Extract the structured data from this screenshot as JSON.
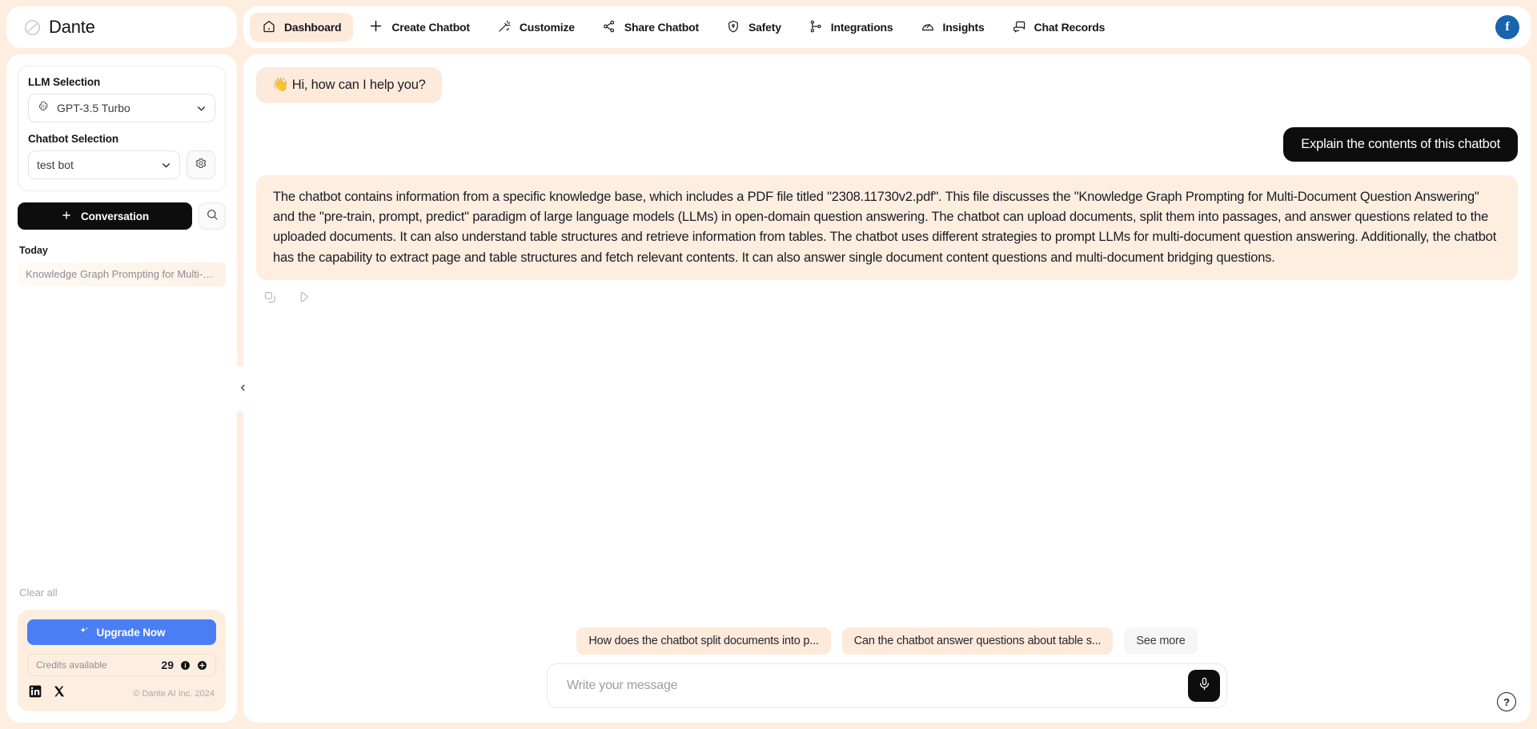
{
  "brand": {
    "name": "Dante",
    "logo_icon": "dante-logo-icon"
  },
  "sidebar": {
    "llm_label": "LLM Selection",
    "llm_value": "GPT-3.5 Turbo",
    "llm_icon": "openai-icon",
    "chatbot_label": "Chatbot Selection",
    "chatbot_value": "test bot",
    "settings_icon": "gear-icon",
    "conversation_button": "Conversation",
    "search_icon": "search-icon",
    "today_label": "Today",
    "conversations": [
      {
        "title": "Knowledge Graph Prompting for Multi-D..."
      }
    ],
    "clear_all": "Clear all",
    "upgrade_button": "Upgrade Now",
    "credits_label": "Credits available",
    "credits_value": "29",
    "info_icon": "info-icon",
    "add_icon": "plus-circle-icon",
    "social": [
      {
        "name": "linkedin-icon"
      },
      {
        "name": "x-twitter-icon"
      }
    ],
    "copyright": "© Dante AI Inc. 2024",
    "collapse_icon": "chevron-left-icon"
  },
  "topbar": {
    "nav": [
      {
        "label": "Dashboard",
        "icon": "home-icon",
        "active": true
      },
      {
        "label": "Create Chatbot",
        "icon": "plus-icon",
        "active": false
      },
      {
        "label": "Customize",
        "icon": "magic-wand-icon",
        "active": false
      },
      {
        "label": "Share Chatbot",
        "icon": "share-icon",
        "active": false
      },
      {
        "label": "Safety",
        "icon": "shield-icon",
        "active": false
      },
      {
        "label": "Integrations",
        "icon": "integrations-icon",
        "active": false
      },
      {
        "label": "Insights",
        "icon": "gauge-icon",
        "active": false
      },
      {
        "label": "Chat Records",
        "icon": "chat-bubble-icon",
        "active": false
      }
    ],
    "avatar_letter": "f"
  },
  "chat": {
    "greeting": "👋 Hi, how can I help you?",
    "user_message": "Explain the contents of this chatbot",
    "assistant_message": "The chatbot contains information from a specific knowledge base, which includes a PDF file titled \"2308.11730v2.pdf\". This file discusses the \"Knowledge Graph Prompting for Multi-Document Question Answering\" and the \"pre-train, prompt, predict\" paradigm of large language models (LLMs) in open-domain question answering. The chatbot can upload documents, split them into passages, and answer questions related to the uploaded documents. It can also understand table structures and retrieve information from tables. The chatbot uses different strategies to prompt LLMs for multi-document question answering. Additionally, the chatbot has the capability to extract page and table structures and fetch relevant contents. It can also answer single document content questions and multi-document bridging questions.",
    "actions": [
      {
        "name": "copy-icon"
      },
      {
        "name": "play-audio-icon"
      }
    ],
    "suggestions": [
      {
        "label": "How does the chatbot split documents into p...",
        "style": "accent"
      },
      {
        "label": "Can the chatbot answer questions about table s...",
        "style": "accent"
      },
      {
        "label": "See more",
        "style": "plain"
      }
    ],
    "composer_placeholder": "Write your message",
    "composer_value": "",
    "mic_icon": "microphone-icon",
    "help_label": "?"
  },
  "colors": {
    "page_bg": "#fdeee0",
    "accent_soft": "#fdeadb",
    "dark": "#0d0d0d",
    "upgrade_blue": "#4a7ef5",
    "avatar_blue": "#1763ad"
  }
}
